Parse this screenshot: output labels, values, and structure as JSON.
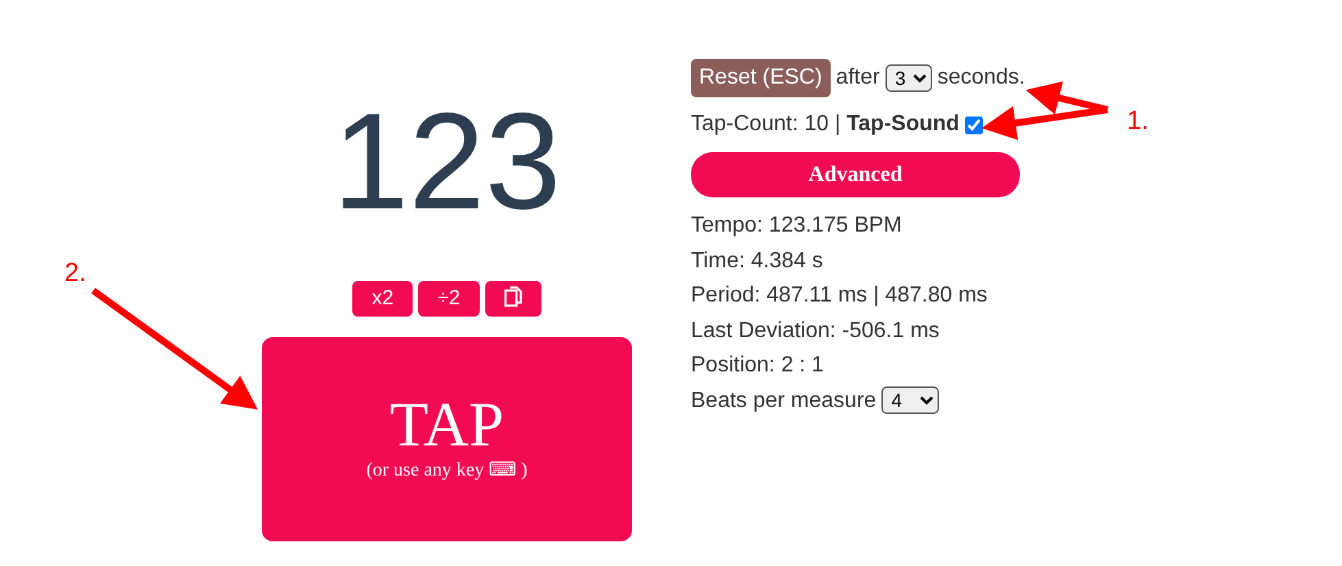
{
  "bpm": "123",
  "tool_buttons": [
    {
      "kind": "text",
      "label": "x2"
    },
    {
      "kind": "text",
      "label": "÷2"
    },
    {
      "kind": "copy"
    }
  ],
  "tap": {
    "label": "TAP",
    "hint": "(or use any key ⌨ )"
  },
  "reset": {
    "button": "Reset (ESC)",
    "prefix": "after",
    "value": "3",
    "suffix": "seconds."
  },
  "tap_sound": {
    "text": "Tap-Count: 10 | **Tap-Sound**",
    "checked": true
  },
  "advanced": "Advanced",
  "stats": [
    "Tempo: 123.175 BPM",
    "Time: 4.384 s",
    "Period: 487.11 ms | 487.80 ms",
    "Last Deviation: -506.1 ms",
    "Position: 2 : 1"
  ],
  "beats": {
    "label": "Beats per measure",
    "value": "4"
  },
  "annotations": [
    {
      "label": "1."
    },
    {
      "label": "2."
    }
  ]
}
